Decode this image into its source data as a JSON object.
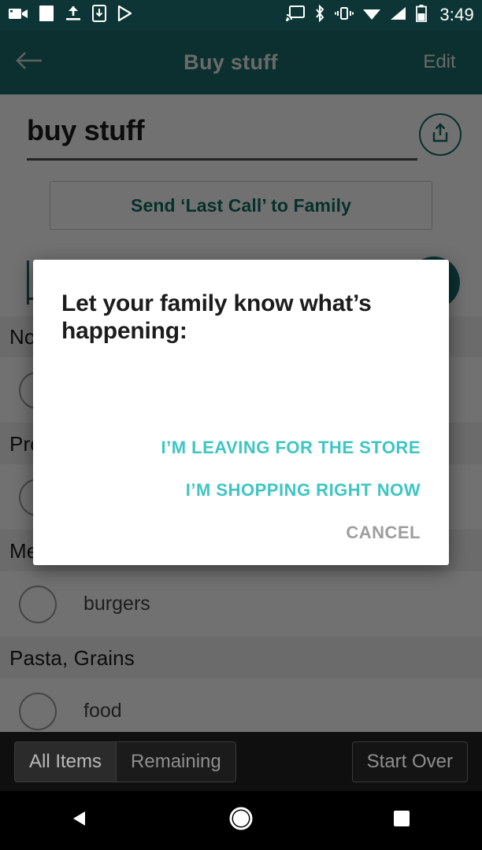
{
  "status_bar": {
    "clock": "3:49",
    "left_icons": [
      "video-camera-icon",
      "screenshot-icon",
      "upload-icon",
      "download-to-device-icon",
      "play-store-icon"
    ],
    "right_icons": [
      "cast-icon",
      "bluetooth-icon",
      "vibrate-icon",
      "wifi-icon",
      "cell-signal-icon",
      "battery-icon"
    ],
    "background": "#0d3535"
  },
  "app_bar": {
    "back_icon": "back-arrow-icon",
    "title": "Buy stuff",
    "edit_label": "Edit",
    "background": "#1a6b68",
    "text_color": "#e8ecec"
  },
  "list_screen": {
    "list_name_value": "buy stuff",
    "share_icon": "share-icon",
    "last_call_label": "Send ‘Last Call’ to Family",
    "last_call_color": "#0e6b5e",
    "add_item_placeholder": "",
    "fab_icon": "plus-icon",
    "sections": [
      {
        "header": "Non-Food Stuff",
        "items": [
          {
            "label": "",
            "checked": false
          }
        ]
      },
      {
        "header": "Produce",
        "items": [
          {
            "label": "",
            "checked": false
          }
        ]
      },
      {
        "header": "Meat & Seafood",
        "items": [
          {
            "label": "burgers",
            "checked": false
          }
        ]
      },
      {
        "header": "Pasta, Grains",
        "items": [
          {
            "label": "food",
            "checked": false
          }
        ]
      }
    ]
  },
  "dialog": {
    "title": "Let your family know what’s happening:",
    "actions": [
      {
        "label": "I’M LEAVING FOR THE STORE",
        "style": "primary"
      },
      {
        "label": "I’M SHOPPING RIGHT NOW",
        "style": "primary"
      },
      {
        "label": "CANCEL",
        "style": "neutral"
      }
    ],
    "primary_color": "#3dc6c3",
    "neutral_color": "#9e9e9e"
  },
  "bottom_bar": {
    "all_items_label": "All Items",
    "remaining_label": "Remaining",
    "start_over_label": "Start Over"
  },
  "nav_bar": {
    "back_icon": "nav-back-triangle-icon",
    "home_icon": "nav-home-circle-icon",
    "recents_icon": "nav-recents-square-icon"
  }
}
